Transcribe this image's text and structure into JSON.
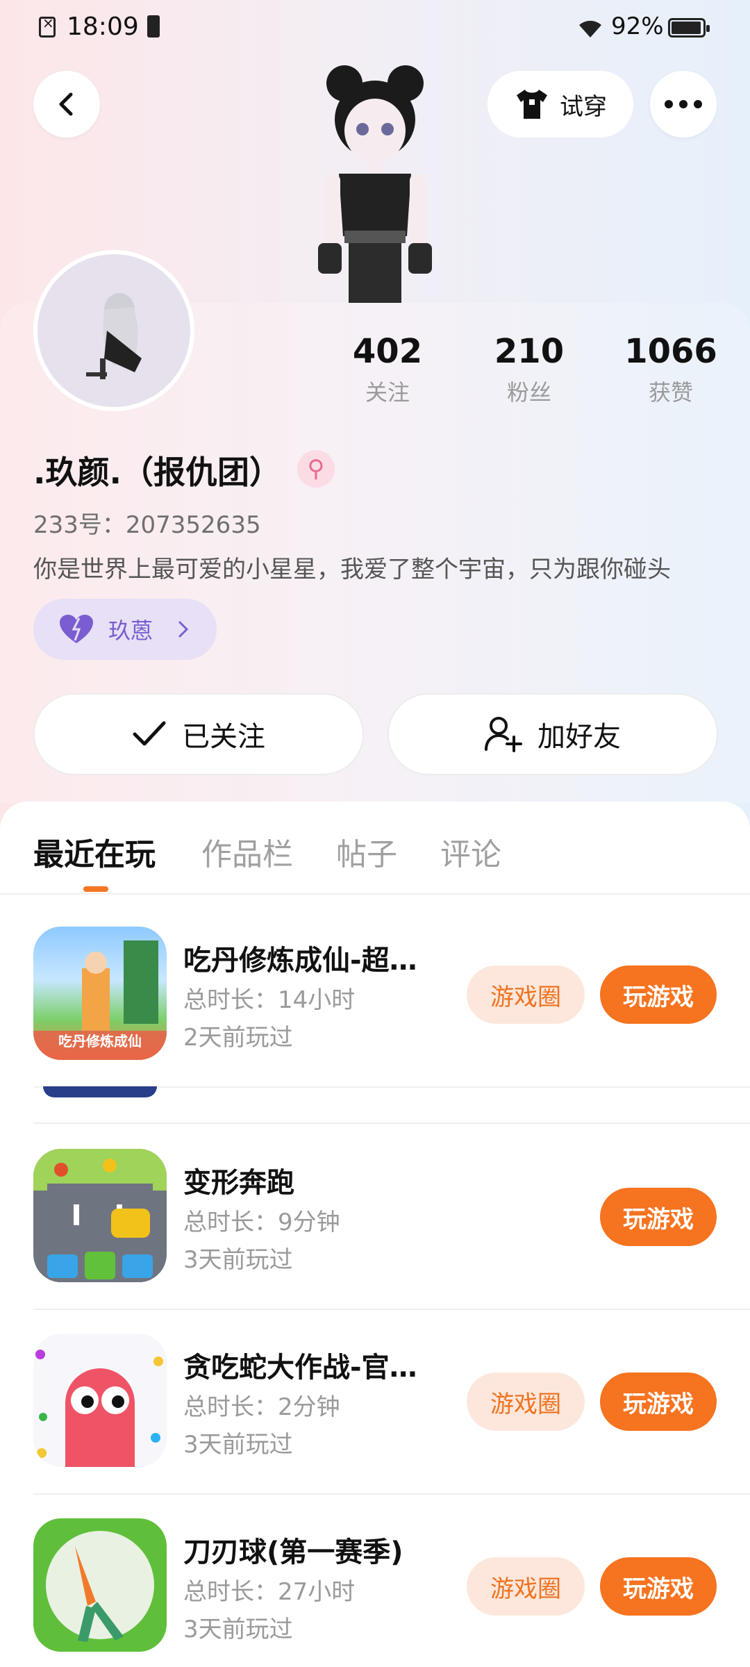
{
  "status_bar": {
    "time": "18:09",
    "battery_pct": "92%"
  },
  "header": {
    "try_on_label": "试穿"
  },
  "profile": {
    "name": ".玖颜.（报仇团）",
    "gender_symbol": "⚲",
    "uid": "233号：207352635",
    "bio": "你是世界上最可爱的小星星，我爱了整个宇宙，只为跟你碰头",
    "pill_label": "玖蒽",
    "stats": [
      {
        "value": "402",
        "label": "关注"
      },
      {
        "value": "210",
        "label": "粉丝"
      },
      {
        "value": "1066",
        "label": "获赞"
      }
    ]
  },
  "actions": {
    "followed_label": "已关注",
    "add_friend_label": "加好友"
  },
  "tabs": [
    {
      "label": "最近在玩",
      "active": true
    },
    {
      "label": "作品栏",
      "active": false
    },
    {
      "label": "帖子",
      "active": false
    },
    {
      "label": "评论",
      "active": false
    }
  ],
  "games": [
    {
      "title": "吃丹修炼成仙-超…",
      "duration": "总时长：14小时",
      "last_played": "2天前玩过",
      "circle_label": "游戏圈",
      "play_label": "玩游戏",
      "icon_text": "吃丹修炼成仙"
    },
    {
      "title": "变形奔跑",
      "duration": "总时长：9分钟",
      "last_played": "3天前玩过",
      "play_label": "玩游戏"
    },
    {
      "title": "贪吃蛇大作战-官…",
      "duration": "总时长：2分钟",
      "last_played": "3天前玩过",
      "circle_label": "游戏圈",
      "play_label": "玩游戏"
    },
    {
      "title": "刀刃球(第一赛季)",
      "duration": "总时长：27小时",
      "last_played": "3天前玩过",
      "circle_label": "游戏圈",
      "play_label": "玩游戏"
    }
  ],
  "colors": {
    "accent": "#f6731f",
    "accent_soft": "#fde7dc",
    "pill_bg": "#e7e0f6",
    "pill_fg": "#7a5dd0"
  }
}
